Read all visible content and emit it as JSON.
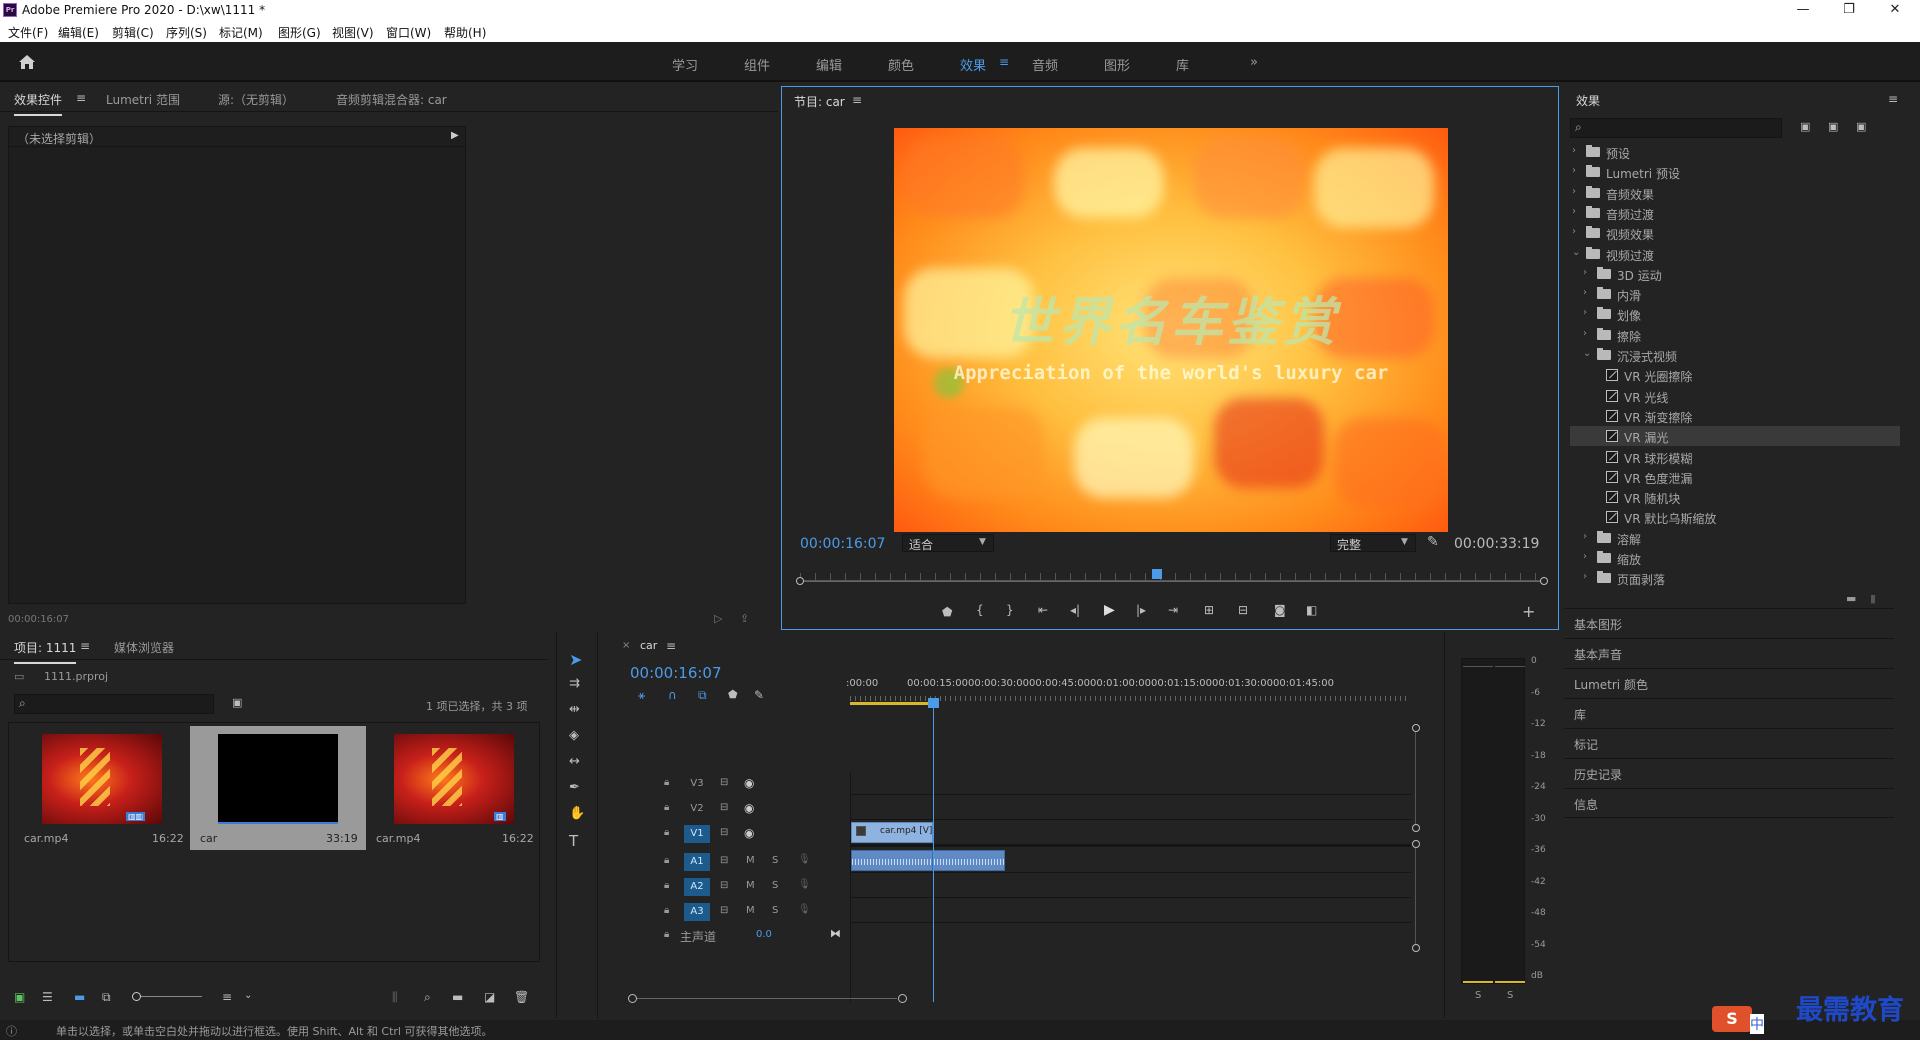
{
  "window": {
    "title": "Adobe Premiere Pro 2020 - D:\\xw\\1111 *",
    "logo": "Pr"
  },
  "menu": [
    "文件(F)",
    "编辑(E)",
    "剪辑(C)",
    "序列(S)",
    "标记(M)",
    "图形(G)",
    "视图(V)",
    "窗口(W)",
    "帮助(H)"
  ],
  "workspaces": {
    "tabs": [
      "学习",
      "组件",
      "编辑",
      "颜色",
      "效果",
      "音频",
      "图形",
      "库"
    ],
    "active": "效果",
    "more": "»"
  },
  "source_panel": {
    "tabs": [
      "效果控件",
      "Lumetri 范围",
      "源:（无剪辑）",
      "音频剪辑混合器: car"
    ],
    "no_clip": "（未选择剪辑）",
    "timecode": "00:00:16:07"
  },
  "program_monitor": {
    "title": "节目: car",
    "video_title": "世界名车鉴赏",
    "video_subtitle": "Appreciation of the world's luxury car",
    "timecode": "00:00:16:07",
    "fit": "适合",
    "quality": "完整",
    "duration": "00:00:33:19",
    "playhead_fraction": 0.48,
    "colors": {
      "accent": "#4c9be8"
    }
  },
  "effects_panel": {
    "title": "效果",
    "tree": [
      {
        "label": "预设",
        "type": "folder",
        "level": 0,
        "expanded": false
      },
      {
        "label": "Lumetri 预设",
        "type": "folder",
        "level": 0,
        "expanded": false
      },
      {
        "label": "音频效果",
        "type": "folder",
        "level": 0,
        "expanded": false
      },
      {
        "label": "音频过渡",
        "type": "folder",
        "level": 0,
        "expanded": false
      },
      {
        "label": "视频效果",
        "type": "folder",
        "level": 0,
        "expanded": false
      },
      {
        "label": "视频过渡",
        "type": "folder",
        "level": 0,
        "expanded": true
      },
      {
        "label": "3D 运动",
        "type": "folder",
        "level": 1,
        "expanded": false
      },
      {
        "label": "内滑",
        "type": "folder",
        "level": 1,
        "expanded": false
      },
      {
        "label": "划像",
        "type": "folder",
        "level": 1,
        "expanded": false
      },
      {
        "label": "擦除",
        "type": "folder",
        "level": 1,
        "expanded": false
      },
      {
        "label": "沉浸式视频",
        "type": "folder",
        "level": 1,
        "expanded": true
      },
      {
        "label": "VR 光圈擦除",
        "type": "fx",
        "level": 2
      },
      {
        "label": "VR 光线",
        "type": "fx",
        "level": 2
      },
      {
        "label": "VR 渐变擦除",
        "type": "fx",
        "level": 2
      },
      {
        "label": "VR 漏光",
        "type": "fx",
        "level": 2,
        "selected": true
      },
      {
        "label": "VR 球形模糊",
        "type": "fx",
        "level": 2
      },
      {
        "label": "VR 色度泄漏",
        "type": "fx",
        "level": 2
      },
      {
        "label": "VR 随机块",
        "type": "fx",
        "level": 2
      },
      {
        "label": "VR 默比乌斯缩放",
        "type": "fx",
        "level": 2
      },
      {
        "label": "溶解",
        "type": "folder",
        "level": 1,
        "expanded": false
      },
      {
        "label": "缩放",
        "type": "folder",
        "level": 1,
        "expanded": false
      },
      {
        "label": "页面剥落",
        "type": "folder",
        "level": 1,
        "expanded": false
      }
    ],
    "side_panels": [
      "基本图形",
      "基本声音",
      "Lumetri 颜色",
      "库",
      "标记",
      "历史记录",
      "信息"
    ]
  },
  "project_panel": {
    "tabs": [
      "项目: 1111",
      "媒体浏览器"
    ],
    "project_file": "1111.prproj",
    "selection_info": "1 项已选择，共 3 项",
    "items": [
      {
        "name": "car.mp4",
        "duration": "16:22",
        "kind": "video"
      },
      {
        "name": "car",
        "duration": "33:19",
        "kind": "sequence",
        "selected": true
      },
      {
        "name": "car.mp4",
        "duration": "16:22",
        "kind": "video"
      }
    ]
  },
  "timeline": {
    "sequence": "car",
    "timecode": "00:00:16:07",
    "ruler": [
      ":00:00",
      "00:00:15:00",
      "00:00:30:00",
      "00:00:45:00",
      "00:01:00:00",
      "00:01:15:00",
      "00:01:30:00",
      "00:01:45:00"
    ],
    "video_tracks": [
      "V3",
      "V2",
      "V1"
    ],
    "audio_tracks": [
      "A1",
      "A2",
      "A3"
    ],
    "master": {
      "label": "主声道",
      "value": "0.0"
    },
    "clip_label": "car.mp4 [V]",
    "mute": "M",
    "solo": "S"
  },
  "audio_meter": {
    "scale": [
      "0",
      "-6",
      "-12",
      "-18",
      "-24",
      "-30",
      "-36",
      "-42",
      "-48",
      "-54",
      "dB"
    ],
    "buttons": [
      "S",
      "S"
    ]
  },
  "status": {
    "text": "单击以选择，或单击空白处并拖动以进行框选。使用 Shift、Alt 和 Ctrl 可获得其他选项。"
  },
  "watermark": {
    "text": "最需教育",
    "ime": "中"
  }
}
